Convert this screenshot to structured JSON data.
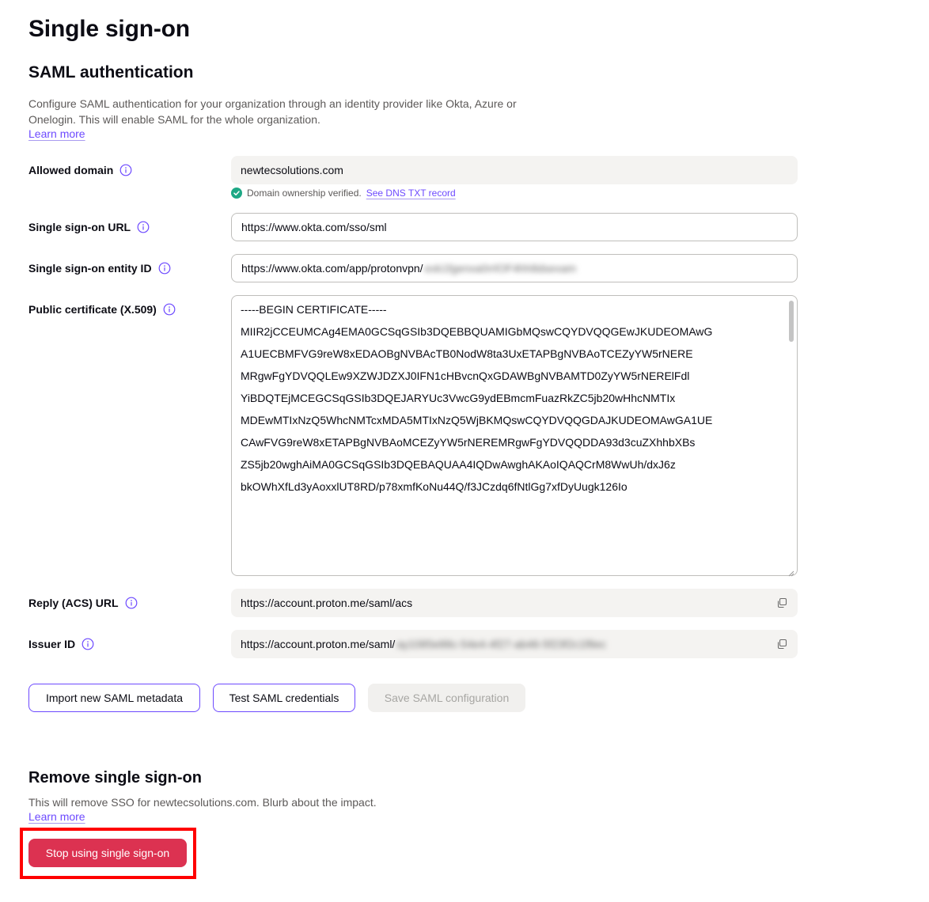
{
  "page": {
    "title": "Single sign-on"
  },
  "saml": {
    "title": "SAML authentication",
    "description": "Configure SAML authentication for your organization through an identity provider like Okta, Azure or Onelogin. This will enable SAML for the whole organization.",
    "learn_more": "Learn more",
    "fields": {
      "allowed_domain": {
        "label": "Allowed domain",
        "value": "newtecsolutions.com"
      },
      "verification": {
        "text": "Domain ownership verified.",
        "link": "See DNS TXT record"
      },
      "sso_url": {
        "label": "Single sign-on URL",
        "value": "https://www.okta.com/sso/sml"
      },
      "entity_id": {
        "label": "Single sign-on entity ID",
        "value": "https://www.okta.com/app/protonvpn/",
        "blurred": "exk1fgenxa0rrlOF4hh8dsexam"
      },
      "certificate": {
        "label": "Public certificate (X.509)",
        "lines": [
          "-----BEGIN CERTIFICATE-----",
          "MIIR2jCCEUMCAg4EMA0GCSqGSIb3DQEBBQUAMIGbMQswCQYDVQQGEwJKUDEOMAwG",
          "A1UECBMFVG9reW8xEDAOBgNVBAcTB0NodW8ta3UxETAPBgNVBAoTCEZyYW5rNERE",
          "MRgwFgYDVQQLEw9XZWJDZXJ0IFN1cHBvcnQxGDAWBgNVBAMTD0ZyYW5rNERElFdl",
          "YiBDQTEjMCEGCSqGSIb3DQEJARYUc3VwcG9ydEBmcmFuazRkZC5jb20wHhcNMTIx",
          "MDEwMTIxNzQ5WhcNMTcxMDA5MTIxNzQ5WjBKMQswCQYDVQQGDAJKUDEOMAwGA1UE",
          "CAwFVG9reW8xETAPBgNVBAoMCEZyYW5rNEREMRgwFgYDVQQDDA93d3cuZXhhbXBs",
          "ZS5jb20wghAiMA0GCSqGSIb3DQEBAQUAA4IQDwAwghAKAoIQAQCrM8WwUh/dxJ6z",
          "bkOWhXfLd3yAoxxlUT8RD/p78xmfKoNu44Q/f3JCzdq6fNtlGg7xfDyUugk126Io"
        ]
      },
      "reply_url": {
        "label": "Reply (ACS) URL",
        "value": "https://account.proton.me/saml/acs"
      },
      "issuer_id": {
        "label": "Issuer ID",
        "value": "https://account.proton.me/saml/",
        "blurred": "ay1085e88c-54e4-4f27-ab46-5f23f2c1f8ec"
      }
    },
    "buttons": {
      "import": "Import new SAML metadata",
      "test": "Test SAML credentials",
      "save": "Save SAML configuration"
    }
  },
  "remove": {
    "title": "Remove single sign-on",
    "description": "This will remove SSO for newtecsolutions.com. Blurb about the impact.",
    "learn_more": "Learn more",
    "button": "Stop using single sign-on"
  },
  "colors": {
    "accent": "#6d4aff",
    "danger": "#dc3251",
    "success": "#1ea885",
    "highlight": "#ff0000"
  }
}
